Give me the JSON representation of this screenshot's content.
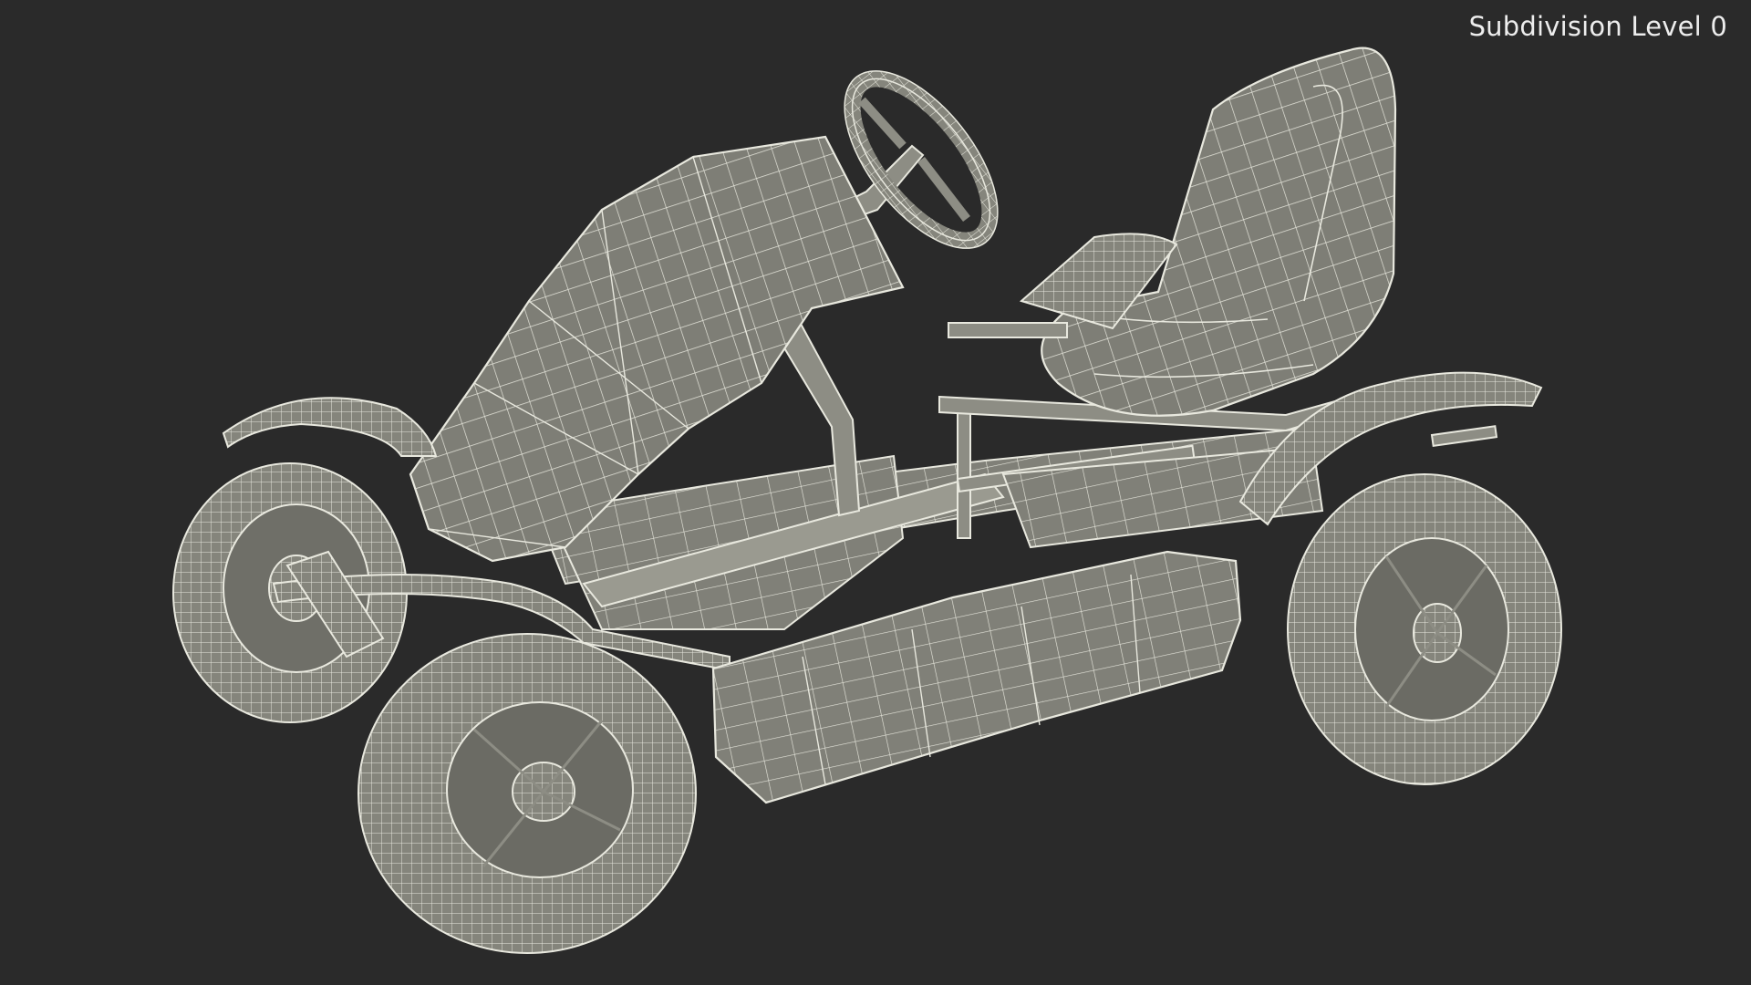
{
  "viewport": {
    "subdivision_label": "Subdivision Level 0",
    "background_color": "#2a2a2a",
    "model_fill_color": "#8a8a80",
    "wire_color": "#e6e6dc"
  },
  "model": {
    "parts": [
      "rear-left-wheel",
      "front-left-wheel",
      "right-wheel",
      "steering-wheel",
      "seat",
      "front-fairing",
      "side-panel",
      "chassis-frame",
      "front-fender",
      "rear-fender"
    ]
  }
}
